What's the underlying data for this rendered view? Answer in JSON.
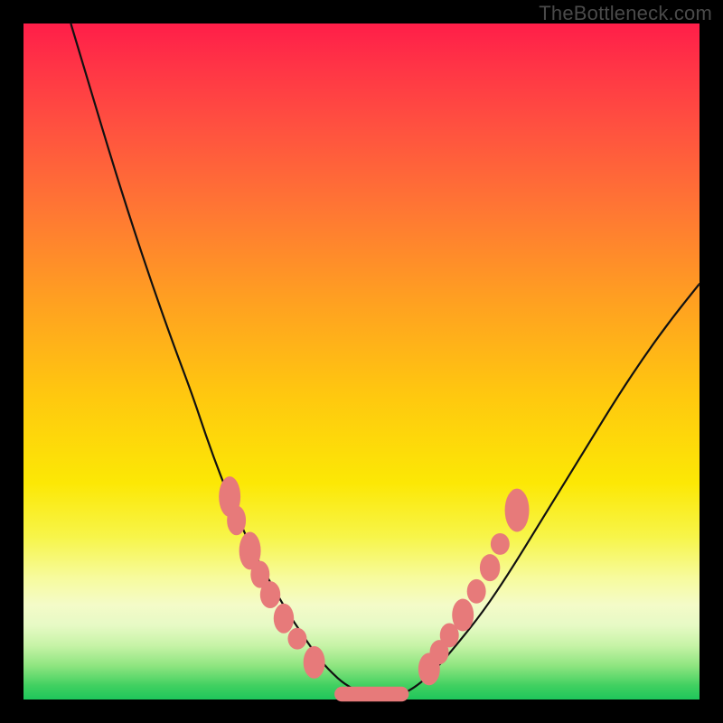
{
  "watermark": "TheBottleneck.com",
  "colors": {
    "page_bg": "#000000",
    "watermark": "#4a4a4a",
    "curve": "#111111",
    "blob": "#e77a7a",
    "gradient_top": "#ff1e49",
    "gradient_bottom": "#1fc65b"
  },
  "chart_data": {
    "type": "line",
    "title": "",
    "xlabel": "",
    "ylabel": "",
    "xlim": [
      0,
      100
    ],
    "ylim": [
      0,
      100
    ],
    "grid": false,
    "legend": false,
    "curve": {
      "name": "bottleneck-curve",
      "x": [
        7,
        10,
        13,
        16,
        19,
        22,
        25,
        27,
        29,
        31,
        33,
        35,
        37,
        39,
        41,
        43,
        45,
        48,
        52,
        55,
        58,
        61,
        64,
        68,
        72,
        76,
        80,
        84,
        88,
        92,
        96,
        100
      ],
      "y": [
        100,
        90,
        80,
        70.5,
        61.5,
        53,
        45,
        39,
        33.5,
        28.5,
        24,
        20,
        16.5,
        13,
        10,
        7,
        4.5,
        1.8,
        0.3,
        0.3,
        1.8,
        4.5,
        8,
        13,
        19,
        25.5,
        32,
        38.5,
        45,
        51,
        56.5,
        61.5
      ]
    },
    "markers": [
      {
        "x": 30.5,
        "y": 30,
        "rx": 1.6,
        "ry": 3.0
      },
      {
        "x": 31.5,
        "y": 26.5,
        "rx": 1.4,
        "ry": 2.2
      },
      {
        "x": 33.5,
        "y": 22,
        "rx": 1.6,
        "ry": 2.8
      },
      {
        "x": 35.0,
        "y": 18.5,
        "rx": 1.4,
        "ry": 2.0
      },
      {
        "x": 36.5,
        "y": 15.5,
        "rx": 1.5,
        "ry": 2.0
      },
      {
        "x": 38.5,
        "y": 12,
        "rx": 1.5,
        "ry": 2.2
      },
      {
        "x": 40.5,
        "y": 9,
        "rx": 1.4,
        "ry": 1.6
      },
      {
        "x": 43.0,
        "y": 5.5,
        "rx": 1.6,
        "ry": 2.4
      },
      {
        "x": 60.0,
        "y": 4.5,
        "rx": 1.6,
        "ry": 2.4
      },
      {
        "x": 61.5,
        "y": 7.0,
        "rx": 1.4,
        "ry": 1.8
      },
      {
        "x": 63.0,
        "y": 9.5,
        "rx": 1.4,
        "ry": 1.8
      },
      {
        "x": 65.0,
        "y": 12.5,
        "rx": 1.6,
        "ry": 2.4
      },
      {
        "x": 67.0,
        "y": 16.0,
        "rx": 1.4,
        "ry": 1.8
      },
      {
        "x": 69.0,
        "y": 19.5,
        "rx": 1.5,
        "ry": 2.0
      },
      {
        "x": 70.5,
        "y": 23.0,
        "rx": 1.4,
        "ry": 1.6
      },
      {
        "x": 73.0,
        "y": 28.0,
        "rx": 1.8,
        "ry": 3.2
      }
    ],
    "trough_bar": {
      "x_start": 46,
      "x_end": 57,
      "y": 0.8,
      "height": 2.2
    }
  }
}
